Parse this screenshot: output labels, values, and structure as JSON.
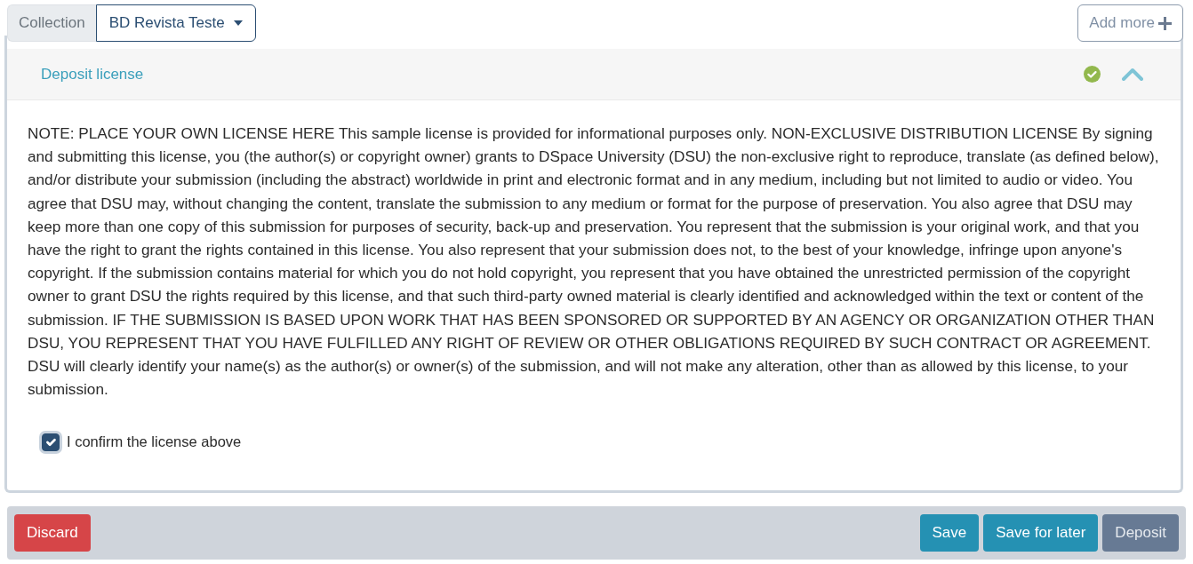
{
  "collection": {
    "label": "Collection",
    "value": "BD Revista Teste"
  },
  "add_more": {
    "label": "Add more"
  },
  "section": {
    "title": "Deposit license",
    "valid": true,
    "expanded": true,
    "license_text": "NOTE: PLACE YOUR OWN LICENSE HERE This sample license is provided for informational purposes only. NON-EXCLUSIVE DISTRIBUTION LICENSE By signing and submitting this license, you (the author(s) or copyright owner) grants to DSpace University (DSU) the non-exclusive right to reproduce, translate (as defined below), and/or distribute your submission (including the abstract) worldwide in print and electronic format and in any medium, including but not limited to audio or video. You agree that DSU may, without changing the content, translate the submission to any medium or format for the purpose of preservation. You also agree that DSU may keep more than one copy of this submission for purposes of security, back-up and preservation. You represent that the submission is your original work, and that you have the right to grant the rights contained in this license. You also represent that your submission does not, to the best of your knowledge, infringe upon anyone's copyright. If the submission contains material for which you do not hold copyright, you represent that you have obtained the unrestricted permission of the copyright owner to grant DSU the rights required by this license, and that such third-party owned material is clearly identified and acknowledged within the text or content of the submission. IF THE SUBMISSION IS BASED UPON WORK THAT HAS BEEN SPONSORED OR SUPPORTED BY AN AGENCY OR ORGANIZATION OTHER THAN DSU, YOU REPRESENT THAT YOU HAVE FULFILLED ANY RIGHT OF REVIEW OR OTHER OBLIGATIONS REQUIRED BY SUCH CONTRACT OR AGREEMENT. DSU will clearly identify your name(s) as the author(s) or owner(s) of the submission, and will not make any alteration, other than as allowed by this license, to your submission.",
    "confirm": {
      "label": "I confirm the license above",
      "checked": true
    }
  },
  "buttons": [
    {
      "label": "Discard",
      "kind": "danger"
    },
    {
      "label": "Save",
      "kind": "info"
    },
    {
      "label": "Save for later",
      "kind": "info"
    },
    {
      "label": "Deposit",
      "kind": "secondary"
    }
  ]
}
